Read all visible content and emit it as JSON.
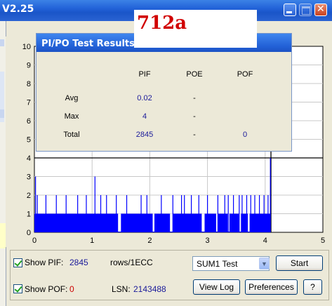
{
  "window": {
    "title": "V2.25"
  },
  "label_overlay": {
    "text": "712a"
  },
  "popup": {
    "title": "PI/PO Test Results",
    "columns": [
      "PIF",
      "POE",
      "POF"
    ],
    "rows": [
      {
        "label": "Avg",
        "values": [
          "0.02",
          "-",
          ""
        ]
      },
      {
        "label": "Max",
        "values": [
          "4",
          "-",
          ""
        ]
      },
      {
        "label": "Total",
        "values": [
          "2845",
          "-",
          "0"
        ]
      }
    ]
  },
  "chart_data": {
    "type": "bar",
    "xlim": [
      0,
      5
    ],
    "ylim": [
      0,
      10
    ],
    "x_ticks": [
      "0",
      "1",
      "2",
      "3",
      "4",
      "5"
    ],
    "y_ticks": [
      "0",
      "1",
      "2",
      "3",
      "4",
      "5",
      "6",
      "7",
      "8",
      "9",
      "10"
    ],
    "threshold_line": 4,
    "end_marker_x": 4.1,
    "series": [
      {
        "color": "#0000ff",
        "baseline_value": 1,
        "spikes": [
          {
            "x": 0.02,
            "y": 3
          },
          {
            "x": 0.05,
            "y": 2
          },
          {
            "x": 0.2,
            "y": 2
          },
          {
            "x": 0.38,
            "y": 2
          },
          {
            "x": 0.55,
            "y": 2
          },
          {
            "x": 0.75,
            "y": 2
          },
          {
            "x": 0.9,
            "y": 2
          },
          {
            "x": 1.05,
            "y": 3
          },
          {
            "x": 1.15,
            "y": 2
          },
          {
            "x": 1.25,
            "y": 2
          },
          {
            "x": 1.42,
            "y": 2
          },
          {
            "x": 1.6,
            "y": 2
          },
          {
            "x": 1.85,
            "y": 2
          },
          {
            "x": 1.95,
            "y": 2
          },
          {
            "x": 2.2,
            "y": 2
          },
          {
            "x": 2.4,
            "y": 2
          },
          {
            "x": 2.55,
            "y": 2
          },
          {
            "x": 2.6,
            "y": 2
          },
          {
            "x": 2.72,
            "y": 2
          },
          {
            "x": 2.85,
            "y": 2
          },
          {
            "x": 3.0,
            "y": 2
          },
          {
            "x": 3.18,
            "y": 2
          },
          {
            "x": 3.3,
            "y": 2
          },
          {
            "x": 3.36,
            "y": 2
          },
          {
            "x": 3.45,
            "y": 2
          },
          {
            "x": 3.55,
            "y": 2
          },
          {
            "x": 3.6,
            "y": 2
          },
          {
            "x": 3.68,
            "y": 2
          },
          {
            "x": 3.75,
            "y": 2
          },
          {
            "x": 3.82,
            "y": 2
          },
          {
            "x": 3.9,
            "y": 2
          },
          {
            "x": 3.98,
            "y": 2
          },
          {
            "x": 4.05,
            "y": 2
          },
          {
            "x": 4.09,
            "y": 4
          }
        ],
        "gaps": [
          {
            "from": 1.45,
            "to": 1.5
          },
          {
            "from": 2.05,
            "to": 2.08
          },
          {
            "from": 2.35,
            "to": 2.4
          },
          {
            "from": 2.9,
            "to": 2.95
          },
          {
            "from": 3.15,
            "to": 3.18
          },
          {
            "from": 3.35,
            "to": 3.38
          },
          {
            "from": 3.55,
            "to": 3.58
          },
          {
            "from": 3.7,
            "to": 3.73
          }
        ]
      }
    ]
  },
  "bottom": {
    "show_pif_label": "Show PIF:",
    "show_pif_value": "2845",
    "rows_label": "rows/1ECC",
    "show_pof_label": "Show POF:",
    "show_pof_value": "0",
    "lsn_label": "LSN:",
    "lsn_value": "2143488",
    "test_select": "SUM1 Test",
    "start_button": "Start",
    "view_log_button": "View Log",
    "preferences_button": "Preferences",
    "help_button": "?"
  }
}
